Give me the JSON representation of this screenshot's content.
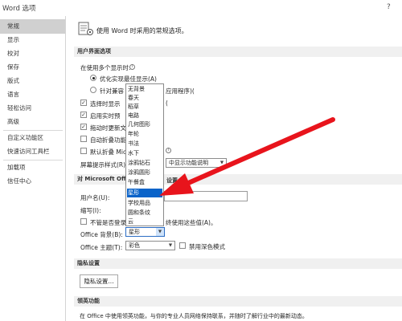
{
  "window": {
    "title": "Word 选项",
    "help": "?"
  },
  "sidebar": {
    "items": [
      "常规",
      "显示",
      "校对",
      "保存",
      "版式",
      "语言",
      "轻松访问",
      "高级",
      "自定义功能区",
      "快速访问工具栏",
      "加载项",
      "信任中心"
    ]
  },
  "header": {
    "text": "使用 Word 时采用的常规选项。"
  },
  "ui_section": {
    "title": "用户界面选项",
    "multi_display_label": "在使用多个显示时:",
    "radio1_label": "优化实现最佳显示(A)",
    "radio2_label_start": "针对兼容",
    "radio2_label_end": "应用程序)(",
    "checkboxes": [
      {
        "label": "选择时显示",
        "label_tail": "(",
        "checked": true
      },
      {
        "label": "启用实时预",
        "label_tail": "",
        "checked": true
      },
      {
        "label": "拖动时更新文",
        "label_tail": "",
        "checked": true
      },
      {
        "label": "自动折叠功能",
        "label_tail": "",
        "checked": false
      },
      {
        "label": "默认折叠 Mic",
        "label_tail": "",
        "checked": false
      }
    ],
    "screentip_label": "屏幕提示样式(R):",
    "screentip_value": "中显示功能说明"
  },
  "personalize_section": {
    "title_start": "对 Microsoft Offic",
    "title_end": "设置",
    "username_label": "用户名(U):",
    "initials_label": "缩写(I):",
    "always_use_start": "不管是否登录",
    "always_use_end": "终使用这些值(A)。",
    "background_label": "Office 背景(B):",
    "background_value": "星形",
    "theme_label": "Office 主题(T):",
    "theme_value": "彩色",
    "dark_mode_label": "禁用深色模式"
  },
  "dropdown": {
    "items": [
      "无背景",
      "春天",
      "稻草",
      "电路",
      "几何图形",
      "年轮",
      "书法",
      "水下",
      "涂鸦钻石",
      "涂鸦圆形",
      "午餐盒",
      "星形",
      "学校用品",
      "圆和条纹",
      "云"
    ],
    "selected": "星形"
  },
  "privacy_section": {
    "title": "隐私设置",
    "button_label": "隐私设置..."
  },
  "linkedin_section": {
    "title": "领英功能",
    "description": "在 Office 中使用领英功能，与你的专业人员网络保持联系，并随时了解行业中的最新动态。"
  }
}
